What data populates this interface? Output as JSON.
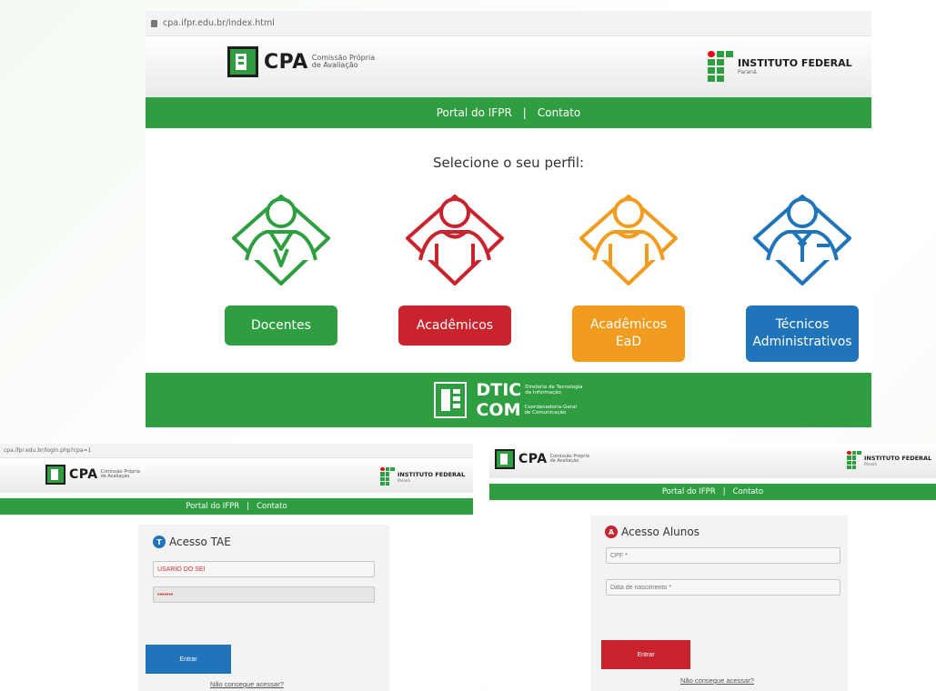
{
  "colors": {
    "green": "#2f9e41",
    "red": "#c9232d",
    "orange": "#f29c1f",
    "blue": "#1f74ba",
    "if_red": "#e30613"
  },
  "main": {
    "url": "cpa.ifpr.edu.br/index.html",
    "logo": {
      "word": "CPA",
      "sub1": "Comissão Própria",
      "sub2": "de Avaliação"
    },
    "if_logo": {
      "name": "INSTITUTO FEDERAL",
      "sub": "Paraná"
    },
    "nav": {
      "portal": "Portal do IFPR",
      "sep": "|",
      "contact": "Contato"
    },
    "prompt": "Selecione o seu perfil:",
    "profiles": [
      {
        "line1": "Docentes",
        "line2": "",
        "color": "#2f9e41",
        "icon": "teacher-icon"
      },
      {
        "line1": "Acadêmicos",
        "line2": "",
        "color": "#c9232d",
        "icon": "student-icon"
      },
      {
        "line1": "Acadêmicos",
        "line2": "EaD",
        "color": "#f29c1f",
        "icon": "distance-student-icon"
      },
      {
        "line1": "Técnicos",
        "line2": "Administrativos",
        "color": "#1f74ba",
        "icon": "technician-icon"
      }
    ],
    "footer": {
      "dtic": "DTIC",
      "dtic_desc1": "Diretoria de Tecnologia",
      "dtic_desc2": "da Informação",
      "com": "COM",
      "com_desc1": "Coordenadoria-Geral",
      "com_desc2": "de Comunicação"
    }
  },
  "tae": {
    "url": "cpa.ifpr.edu.br/login.php?cpa=1",
    "logo": {
      "word": "CPA",
      "sub1": "Comissão Própria",
      "sub2": "de Avaliação"
    },
    "if_logo": {
      "name": "INSTITUTO FEDERAL",
      "sub": "Paraná"
    },
    "nav": {
      "portal": "Portal do IFPR",
      "sep": "|",
      "contact": "Contato"
    },
    "badge": "T",
    "title": "Acesso TAE",
    "user_value": "USÁRIO DO SEI",
    "password_value": "•••••••",
    "button": "Entrar",
    "help": "Não consegue acessar?"
  },
  "alunos": {
    "logo": {
      "word": "CPA",
      "sub1": "Comissão Própria",
      "sub2": "de Avaliação"
    },
    "if_logo": {
      "name": "INSTITUTO FEDERAL",
      "sub": "Paraná"
    },
    "nav": {
      "portal": "Portal do IFPR",
      "sep": "|",
      "contact": "Contato"
    },
    "badge": "A",
    "title": "Acesso Alunos",
    "cpf_placeholder": "CPF *",
    "birth_placeholder": "Data de nascimento *",
    "button": "Entrar",
    "help": "Não consegue acessar?"
  }
}
